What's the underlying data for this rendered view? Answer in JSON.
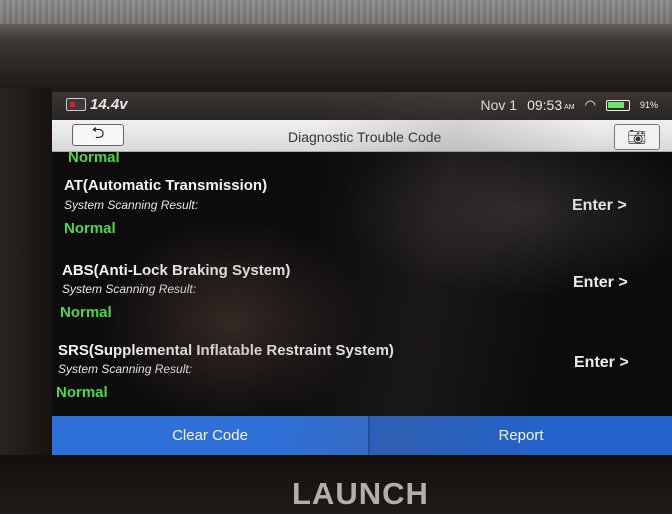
{
  "device": {
    "brand": "LAUNCH"
  },
  "status_bar": {
    "voltage": "14.4v",
    "date": "Nov 1",
    "time": "09:53",
    "ampm": "AM",
    "battery_percent": "91%",
    "accent_green": "#6be26b"
  },
  "title_bar": {
    "title": "Diagnostic Trouble Code",
    "back_icon": "back-arrow-icon",
    "camera_icon": "camera-icon"
  },
  "rows": [
    {
      "name": "",
      "label": "",
      "status": "Normal",
      "enter": ""
    },
    {
      "name": "AT(Automatic Transmission)",
      "label": "System Scanning Result:",
      "status": "Normal",
      "enter": "Enter >"
    },
    {
      "name": "ABS(Anti-Lock Braking System)",
      "label": "System Scanning Result:",
      "status": "Normal",
      "enter": "Enter >"
    },
    {
      "name": "SRS(Supplemental Inflatable Restraint System)",
      "label": "System Scanning Result:",
      "status": "Normal",
      "enter": "Enter >"
    }
  ],
  "bottom_bar": {
    "clear_code": "Clear Code",
    "report": "Report",
    "button_color": "#2f70d8"
  },
  "colors": {
    "status_normal": "#4cd84c"
  }
}
